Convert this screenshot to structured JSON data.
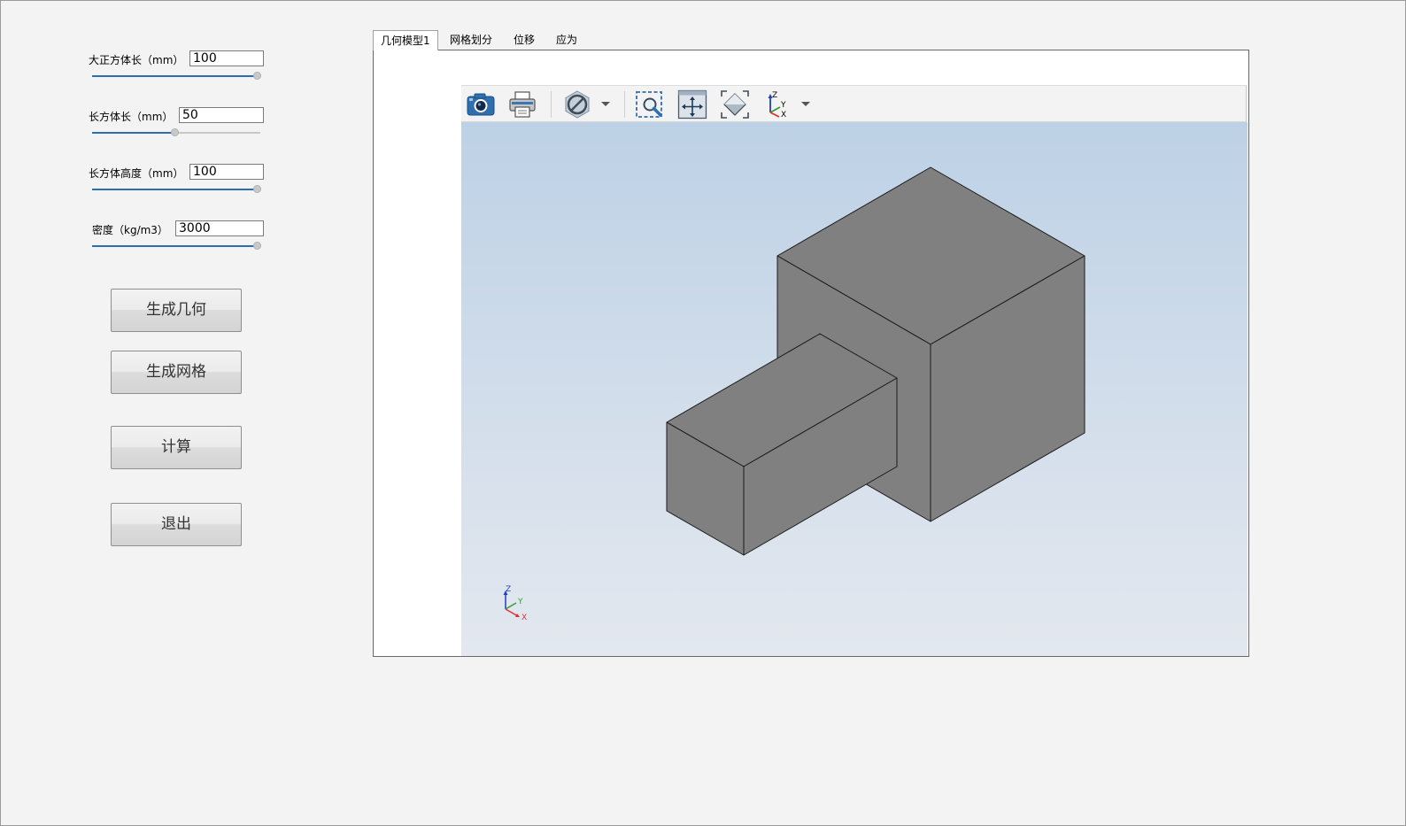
{
  "params": [
    {
      "label": "大正方体长（mm）",
      "value": "100",
      "slider_fraction": 1.0
    },
    {
      "label": "长方体长（mm）",
      "value": "50",
      "slider_fraction": 0.5
    },
    {
      "label": "长方体高度（mm）",
      "value": "100",
      "slider_fraction": 1.0
    },
    {
      "label": "密度（kg/m3）",
      "value": "3000",
      "slider_fraction": 1.0
    }
  ],
  "buttons": {
    "generate_geometry": "生成几何",
    "generate_mesh": "生成网格",
    "compute": "计算",
    "exit": "退出"
  },
  "tabs": [
    {
      "label": "几何模型1",
      "active": true
    },
    {
      "label": "网格划分",
      "active": false
    },
    {
      "label": "位移",
      "active": false
    },
    {
      "label": "应为",
      "active": false
    }
  ],
  "toolbar": {
    "icons": [
      "camera-icon",
      "printer-icon",
      "no-symbol-icon",
      "zoom-window-icon",
      "pan-icon",
      "fit-all-icon",
      "axes-triad-icon"
    ]
  },
  "triad": {
    "z": "Z",
    "y": "Y",
    "x": "X"
  },
  "colors": {
    "accent": "#2b6cb3",
    "model_gray": "#808080",
    "viewport_top": "#bdd1e6",
    "viewport_bottom": "#e3e8ef",
    "axis_x": "#e03030",
    "axis_y": "#30a030",
    "axis_z": "#2040c0"
  }
}
